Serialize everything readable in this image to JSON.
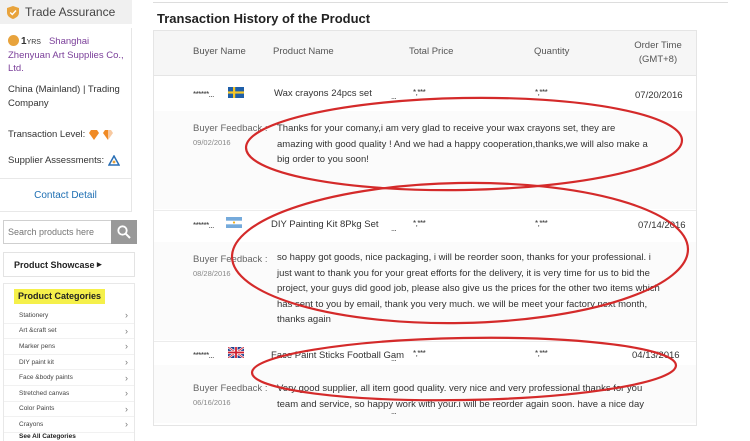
{
  "sidebar": {
    "trade_assurance": "Trade Assurance",
    "supplier": {
      "years_num": "1",
      "years_unit": "YRS",
      "name": "Shanghai Zhenyuan Art Supplies Co., Ltd.",
      "location_type": "China (Mainland) | Trading Company",
      "transaction_level_label": "Transaction Level:",
      "assessments_label": "Supplier Assessments:"
    },
    "contact_label": "Contact Detail",
    "search_placeholder": "Search products here",
    "showcase_label": "Product Showcase",
    "showcase_arrow": "▸",
    "categories_title": "Product Categories",
    "categories": [
      "Stationery",
      "Art &craft set",
      "Marker pens",
      "DIY paint kit",
      "Face &body paints",
      "Stretched canvas",
      "Color Paints",
      "Crayons"
    ],
    "see_all": "See All Categories",
    "colors": {
      "accent": "#7a3e99",
      "link": "#1e6fb3",
      "highlight": "#f5f04a"
    }
  },
  "main": {
    "title": "Transaction History of the Product",
    "columns": {
      "buyer": "Buyer Name",
      "product": "Product Name",
      "price": "Total Price",
      "qty": "Quantity",
      "date": "Order Time",
      "date_sub": "(GMT+8)"
    },
    "transactions": [
      {
        "buyer": "******...",
        "flag": "sweden",
        "product": "Wax crayons 24pcs set",
        "dots": "...",
        "price": "*,***",
        "qty": "*,***",
        "date": "07/20/2016",
        "feedback_label": "Buyer Feedback :",
        "feedback_date": "09/02/2016",
        "feedback_lines": [
          "Thanks for your comany,i am very glad to receive your wax crayons set, they are",
          "amazing with good quality ! And we had a happy cooperation,thanks,we will also make a",
          "big order to you soon!"
        ]
      },
      {
        "buyer": "******...",
        "flag": "argentina",
        "product": "DIY Painting Kit 8Pkg Set",
        "dots": "...",
        "price": "*,***",
        "qty": "*,***",
        "date": "07/14/2016",
        "feedback_label": "Buyer Feedback :",
        "feedback_date": "08/28/2016",
        "feedback_lines": [
          "so happy got goods, nice packaging, i will be reorder soon, thanks for your professional. i",
          "just want to thank you for your great efforts for the delivery, it is very time for us to bid the",
          "project, your guys did good job, please also give us the prices for the other two items which",
          "has sent to you by email, thank you very much. we will be meet your factory next month,",
          "thanks again"
        ]
      },
      {
        "buyer": "******...",
        "flag": "united-kingdom",
        "product": "Face Paint Sticks Football Gam",
        "dots": "...",
        "price": "*,***",
        "qty": "*,***",
        "date": "04/13/2016",
        "feedback_label": "Buyer Feedback :",
        "feedback_date": "06/16/2016",
        "feedback_lines": [
          "Very good supplier, all item good quality. very nice and very professional thanks for you",
          "team and service, so happy work with your.i will be reorder again soon. have a nice day"
        ]
      }
    ],
    "bottom_dots": "...",
    "annotation_color": "#d42a2a"
  }
}
